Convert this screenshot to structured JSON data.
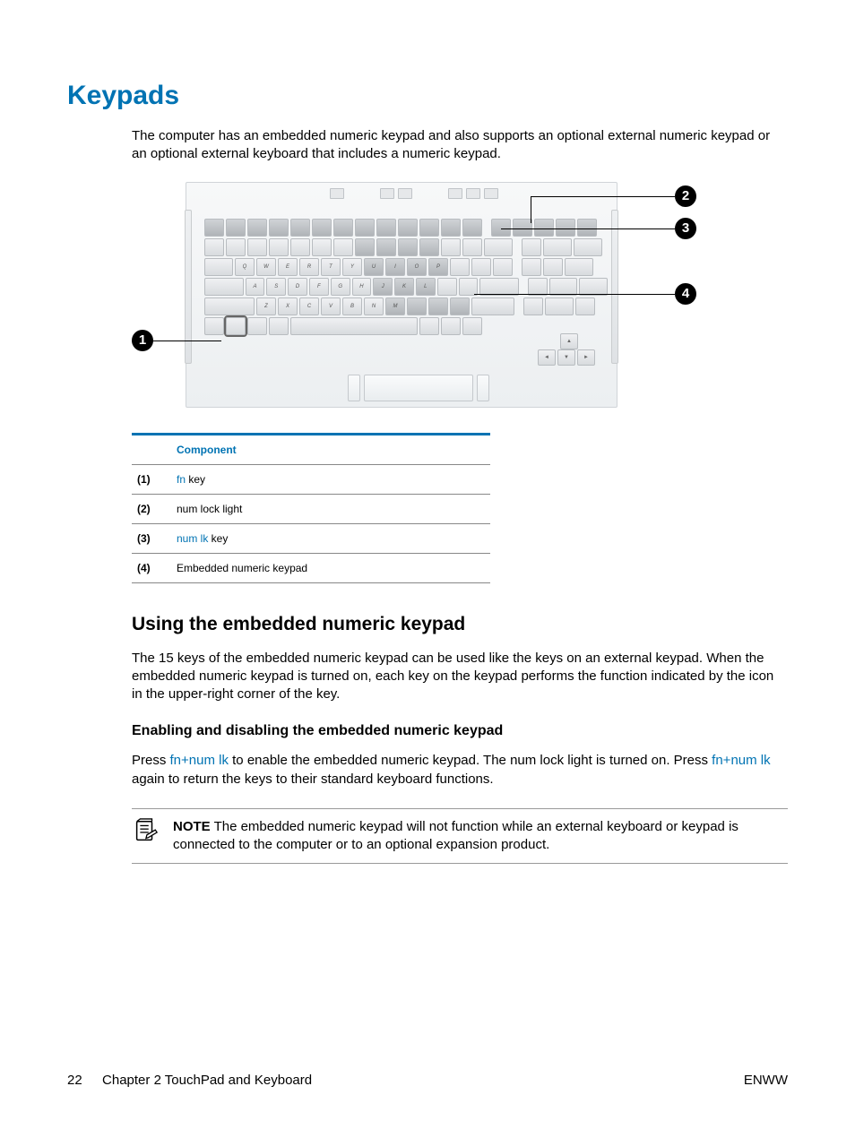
{
  "title": "Keypads",
  "intro": "The computer has an embedded numeric keypad and also supports an optional external numeric keypad or an optional external keyboard that includes a numeric keypad.",
  "callouts": {
    "c1": "1",
    "c2": "2",
    "c3": "3",
    "c4": "4"
  },
  "table": {
    "header": "Component",
    "rows": [
      {
        "idx": "(1)",
        "blue": "fn",
        "rest": " key"
      },
      {
        "idx": "(2)",
        "blue": "",
        "rest": "num lock light"
      },
      {
        "idx": "(3)",
        "blue": "num lk",
        "rest": " key"
      },
      {
        "idx": "(4)",
        "blue": "",
        "rest": "Embedded numeric keypad"
      }
    ]
  },
  "h2": "Using the embedded numeric keypad",
  "p1": "The 15 keys of the embedded numeric keypad can be used like the keys on an external keypad. When the embedded numeric keypad is turned on, each key on the keypad performs the function indicated by the icon in the upper-right corner of the key.",
  "h3": "Enabling and disabling the embedded numeric keypad",
  "p2a": "Press ",
  "p2b": "fn+num lk",
  "p2c": " to enable the embedded numeric keypad. The num lock light is turned on. Press ",
  "p2d": "fn+num lk",
  "p2e": " again to return the keys to their standard keyboard functions.",
  "note": {
    "label": "NOTE",
    "text": "   The embedded numeric keypad will not function while an external keyboard or keypad is connected to the computer or to an optional expansion product."
  },
  "keys": {
    "r2": [
      "Q",
      "W",
      "E",
      "R",
      "T",
      "Y",
      "U",
      "I",
      "O",
      "P"
    ],
    "r3": [
      "A",
      "S",
      "D",
      "F",
      "G",
      "H",
      "J",
      "K",
      "L"
    ],
    "r4": [
      "Z",
      "X",
      "C",
      "V",
      "B",
      "N",
      "M"
    ]
  },
  "footer": {
    "page": "22",
    "chapter": "Chapter 2    TouchPad and Keyboard",
    "right": "ENWW"
  }
}
